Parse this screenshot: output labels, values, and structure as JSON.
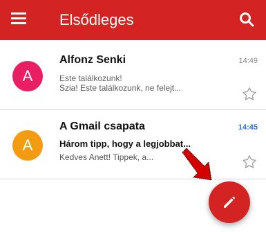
{
  "app": {
    "title": "Elsődleges",
    "accent": "#d32323"
  },
  "icons": {
    "menu": "menu-icon",
    "search": "search-icon",
    "star": "star-outline-icon",
    "compose": "pencil-icon"
  },
  "emails": [
    {
      "avatar_letter": "A",
      "avatar_color": "#e91e63",
      "sender": "Alfonz Senki",
      "time": "14:49",
      "subject": "Este találkozunk!",
      "preview": "Szia! Este találkozunk, ne felejt...",
      "unread": false
    },
    {
      "avatar_letter": "A",
      "avatar_color": "#f39c12",
      "sender": "A Gmail csapata",
      "time": "14:45",
      "subject": "Három tipp, hogy a legjobbat...",
      "preview": "Kedves Anett! Tippek, a...",
      "unread": true
    }
  ],
  "annotation": {
    "type": "red-arrow",
    "color": "#d40000"
  }
}
